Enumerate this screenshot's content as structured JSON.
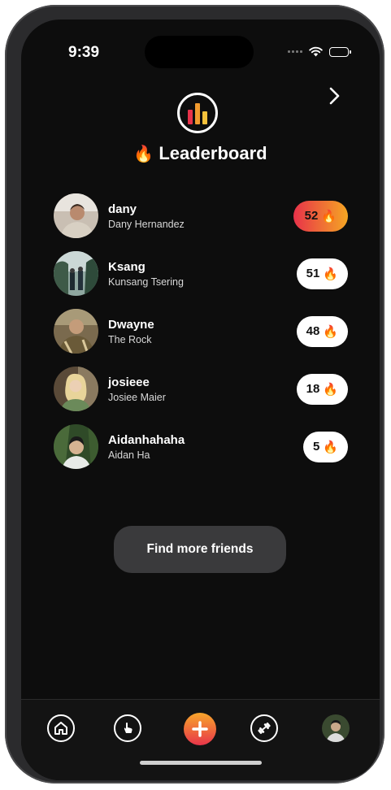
{
  "status_bar": {
    "time": "9:39"
  },
  "header": {
    "title": "Leaderboard",
    "title_emoji": "🔥"
  },
  "leaderboard": [
    {
      "username": "dany",
      "fullname": "Dany Hernandez",
      "score": "52",
      "emoji": "🔥",
      "highlight": true
    },
    {
      "username": "Ksang",
      "fullname": "Kunsang Tsering",
      "score": "51",
      "emoji": "🔥",
      "highlight": false
    },
    {
      "username": "Dwayne",
      "fullname": "The Rock",
      "score": "48",
      "emoji": "🔥",
      "highlight": false
    },
    {
      "username": "josieee",
      "fullname": "Josiee Maier",
      "score": "18",
      "emoji": "🔥",
      "highlight": false
    },
    {
      "username": "Aidanhahaha",
      "fullname": "Aidan Ha",
      "score": "5",
      "emoji": "🔥",
      "highlight": false
    }
  ],
  "actions": {
    "find_friends": "Find more friends"
  },
  "tab_bar": [
    "home-icon",
    "tap-hand-icon",
    "add-icon",
    "dumbbell-icon",
    "profile-avatar"
  ],
  "colors": {
    "accent_start": "#e8324a",
    "accent_end": "#f5a623",
    "background": "#0d0d0d"
  }
}
